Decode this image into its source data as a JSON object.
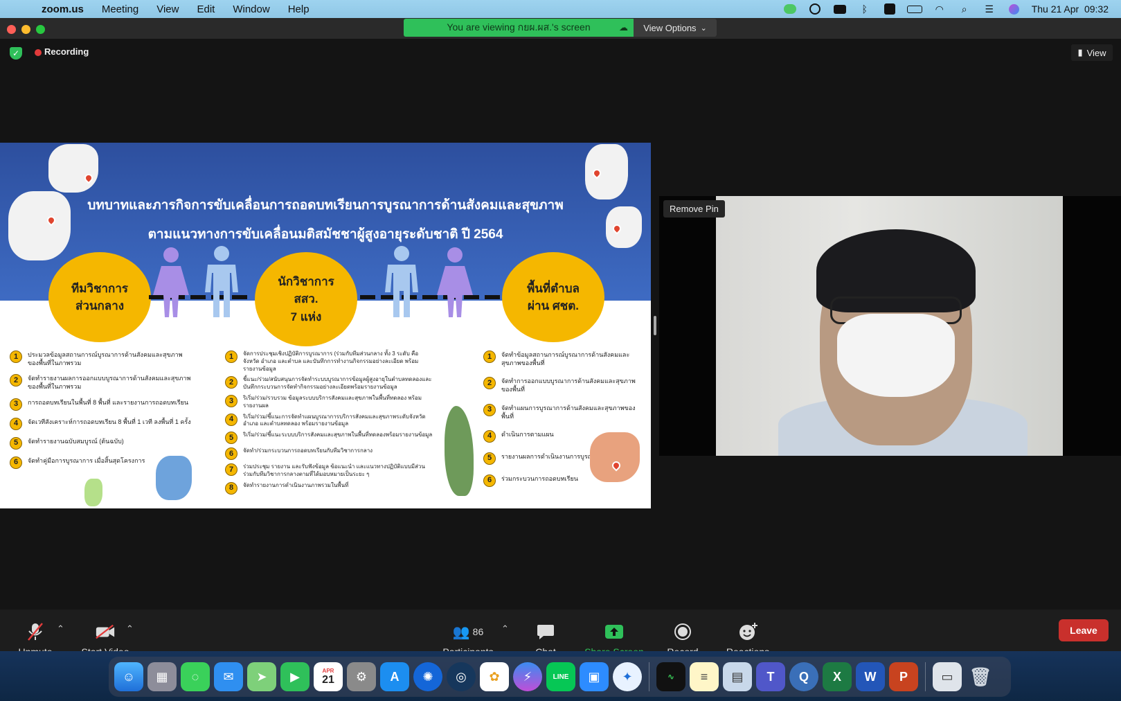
{
  "menubar": {
    "app_name": "zoom.us",
    "items": [
      "Meeting",
      "View",
      "Edit",
      "Window",
      "Help"
    ],
    "clock": "Thu 21 Apr  09:32"
  },
  "window": {
    "share_banner": "You are viewing กยผ.ผส.'s screen",
    "view_options": "View Options",
    "recording_label": "Recording",
    "view_button": "View"
  },
  "slide": {
    "title_line1": "บทบาทและภารกิจการขับเคลื่อนการถอดบทเรียนการบูรณาการด้านสังคมและสุขภาพ",
    "title_line2": "ตามแนวทางการขับเคลื่อนมติสมัชชาผู้สูงอายุระดับชาติ ปี 2564",
    "circles": [
      "ทีมวิชาการ\nส่วนกลาง",
      "นักวิชาการ\nสสว.\n7 แห่ง",
      "พื้นที่ตำบล\nผ่าน ศชต."
    ],
    "col1": [
      {
        "n": "1",
        "text": "ประมวลข้อมูลสถานการณ์บูรณาการด้านสังคมและสุขภาพของพื้นที่ในภาพรวม"
      },
      {
        "n": "2",
        "text": "จัดทำรายงานผลการออกแบบบูรณาการด้านสังคมและสุขภาพของพื้นที่ในภาพรวม"
      },
      {
        "n": "3",
        "text": "การถอดบทเรียนในพื้นที่ 8 พื้นที่ และรายงานการถอดบทเรียน"
      },
      {
        "n": "4",
        "text": "จัดเวทีสังเคราะห์การถอดบทเรียน 8 พื้นที่ 1 เวที ลงพื้นที่ 1 ครั้ง"
      },
      {
        "n": "5",
        "text": "จัดทำรายงานฉบับสมบูรณ์ (ต้นฉบับ)"
      },
      {
        "n": "6",
        "text": "จัดทำคู่มือการบูรณาการ เมื่อสิ้นสุดโครงการ"
      }
    ],
    "col2": [
      {
        "n": "1",
        "text": "จัดการประชุมเชิงปฏิบัติการบูรณาการ (ร่วมกับทีมส่วนกลาง ทั้ง 3 ระดับ คือ จังหวัด อำเภอ และตำบล และบันทึกการทำงานกิจกรรมอย่างละเอียด พร้อมรายงานข้อมูล"
      },
      {
        "n": "2",
        "text": "ชี้แนะ/ร่วม/สนับสนุนการจัดทำระบบบูรณาการข้อมูลผู้สูงอายุในตำบลทดลองและบันทึกกระบวนการจัดทำกิจกรรมอย่างละเอียดพร้อมรายงานข้อมูล"
      },
      {
        "n": "3",
        "text": "ริเริ่ม/ร่วม/รวบรวม ข้อมูลระบบบริการสังคมและสุขภาพในพื้นที่ทดลอง พร้อมรายงานผล"
      },
      {
        "n": "4",
        "text": "ริเริ่ม/ร่วม/ชี้แนะการจัดทำแผนบูรณาการบริการสังคมและสุขภาพระดับจังหวัด อำเภอ และตำบลทดลอง พร้อมรายงานข้อมูล"
      },
      {
        "n": "5",
        "text": "ริเริ่ม/ร่วม/ชี้แนะระบบบริการสังคมและสุขภาพในพื้นที่ทดลองพร้อมรายงานข้อมูล"
      },
      {
        "n": "6",
        "text": "จัดทำ/ร่วมกระบวนการถอดบทเรียนกับทีมวิชาการกลาง"
      },
      {
        "n": "7",
        "text": "ร่วมประชุม รายงาน และรับฟังข้อมูล ข้อแนะนำ และแนวทางปฏิบัติแบบมีส่วนร่วมกับทีมวิชาการกลางตามที่ได้มอบหมายเป็นระยะ ๆ"
      },
      {
        "n": "8",
        "text": "จัดทำรายงานการดำเนินงานภาพรวมในพื้นที่"
      }
    ],
    "col3": [
      {
        "n": "1",
        "text": "จัดทำข้อมูลสถานการณ์บูรณาการด้านสังคมและสุขภาพของพื้นที่"
      },
      {
        "n": "2",
        "text": "จัดทำการออกแบบบูรณาการด้านสังคมและสุขภาพของพื้นที่"
      },
      {
        "n": "3",
        "text": "จัดทำแผนการบูรณาการด้านสังคมและสุขภาพของพื้นที่"
      },
      {
        "n": "4",
        "text": "ดำเนินการตามแผน"
      },
      {
        "n": "5",
        "text": "รายงานผลการดำเนินงานการบูรณาการ"
      },
      {
        "n": "6",
        "text": "ร่วมกระบวนการถอดบทเรียน"
      }
    ]
  },
  "video": {
    "remove_pin": "Remove Pin"
  },
  "toolbar": {
    "unmute": "Unmute",
    "start_video": "Start Video",
    "participants": "Participants",
    "participant_count": "86",
    "chat": "Chat",
    "share_screen": "Share Screen",
    "record": "Record",
    "reactions": "Reactions",
    "leave": "Leave"
  },
  "dock": {
    "calendar_month": "APR",
    "calendar_day": "21"
  }
}
